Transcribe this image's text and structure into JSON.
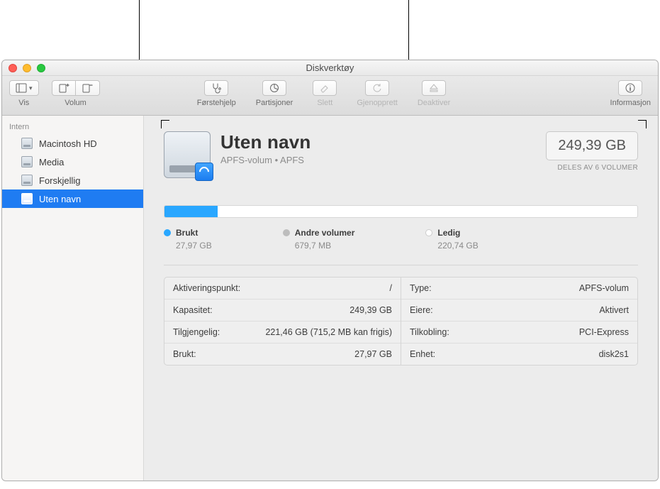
{
  "window": {
    "title": "Diskverktøy"
  },
  "toolbar": {
    "view": {
      "label": "Vis"
    },
    "volume": {
      "label": "Volum"
    },
    "firstaid": "Førstehjelp",
    "partition": "Partisjoner",
    "erase": "Slett",
    "restore": "Gjenopprett",
    "unmount": "Deaktiver",
    "info": "Informasjon"
  },
  "sidebar": {
    "section": "Intern",
    "items": [
      {
        "label": "Macintosh HD"
      },
      {
        "label": "Media"
      },
      {
        "label": "Forskjellig"
      },
      {
        "label": "Uten navn"
      }
    ]
  },
  "header": {
    "name": "Uten navn",
    "subtitle": "APFS-volum • APFS",
    "size": "249,39 GB",
    "shared": "DELES AV 6 VOLUMER"
  },
  "usage": {
    "percent_used": 11.2,
    "legend": [
      {
        "label": "Brukt",
        "value": "27,97 GB",
        "color": "#29a7ff"
      },
      {
        "label": "Andre volumer",
        "value": "679,7 MB",
        "color": "#bdbdbd"
      },
      {
        "label": "Ledig",
        "value": "220,74 GB",
        "color": "#ffffff"
      }
    ]
  },
  "info": {
    "left": [
      {
        "k": "Aktiveringspunkt:",
        "v": "/"
      },
      {
        "k": "Kapasitet:",
        "v": "249,39 GB"
      },
      {
        "k": "Tilgjengelig:",
        "v": "221,46 GB (715,2 MB kan frigis)"
      },
      {
        "k": "Brukt:",
        "v": "27,97 GB"
      }
    ],
    "right": [
      {
        "k": "Type:",
        "v": "APFS-volum"
      },
      {
        "k": "Eiere:",
        "v": "Aktivert"
      },
      {
        "k": "Tilkobling:",
        "v": "PCI-Express"
      },
      {
        "k": "Enhet:",
        "v": "disk2s1"
      }
    ]
  }
}
